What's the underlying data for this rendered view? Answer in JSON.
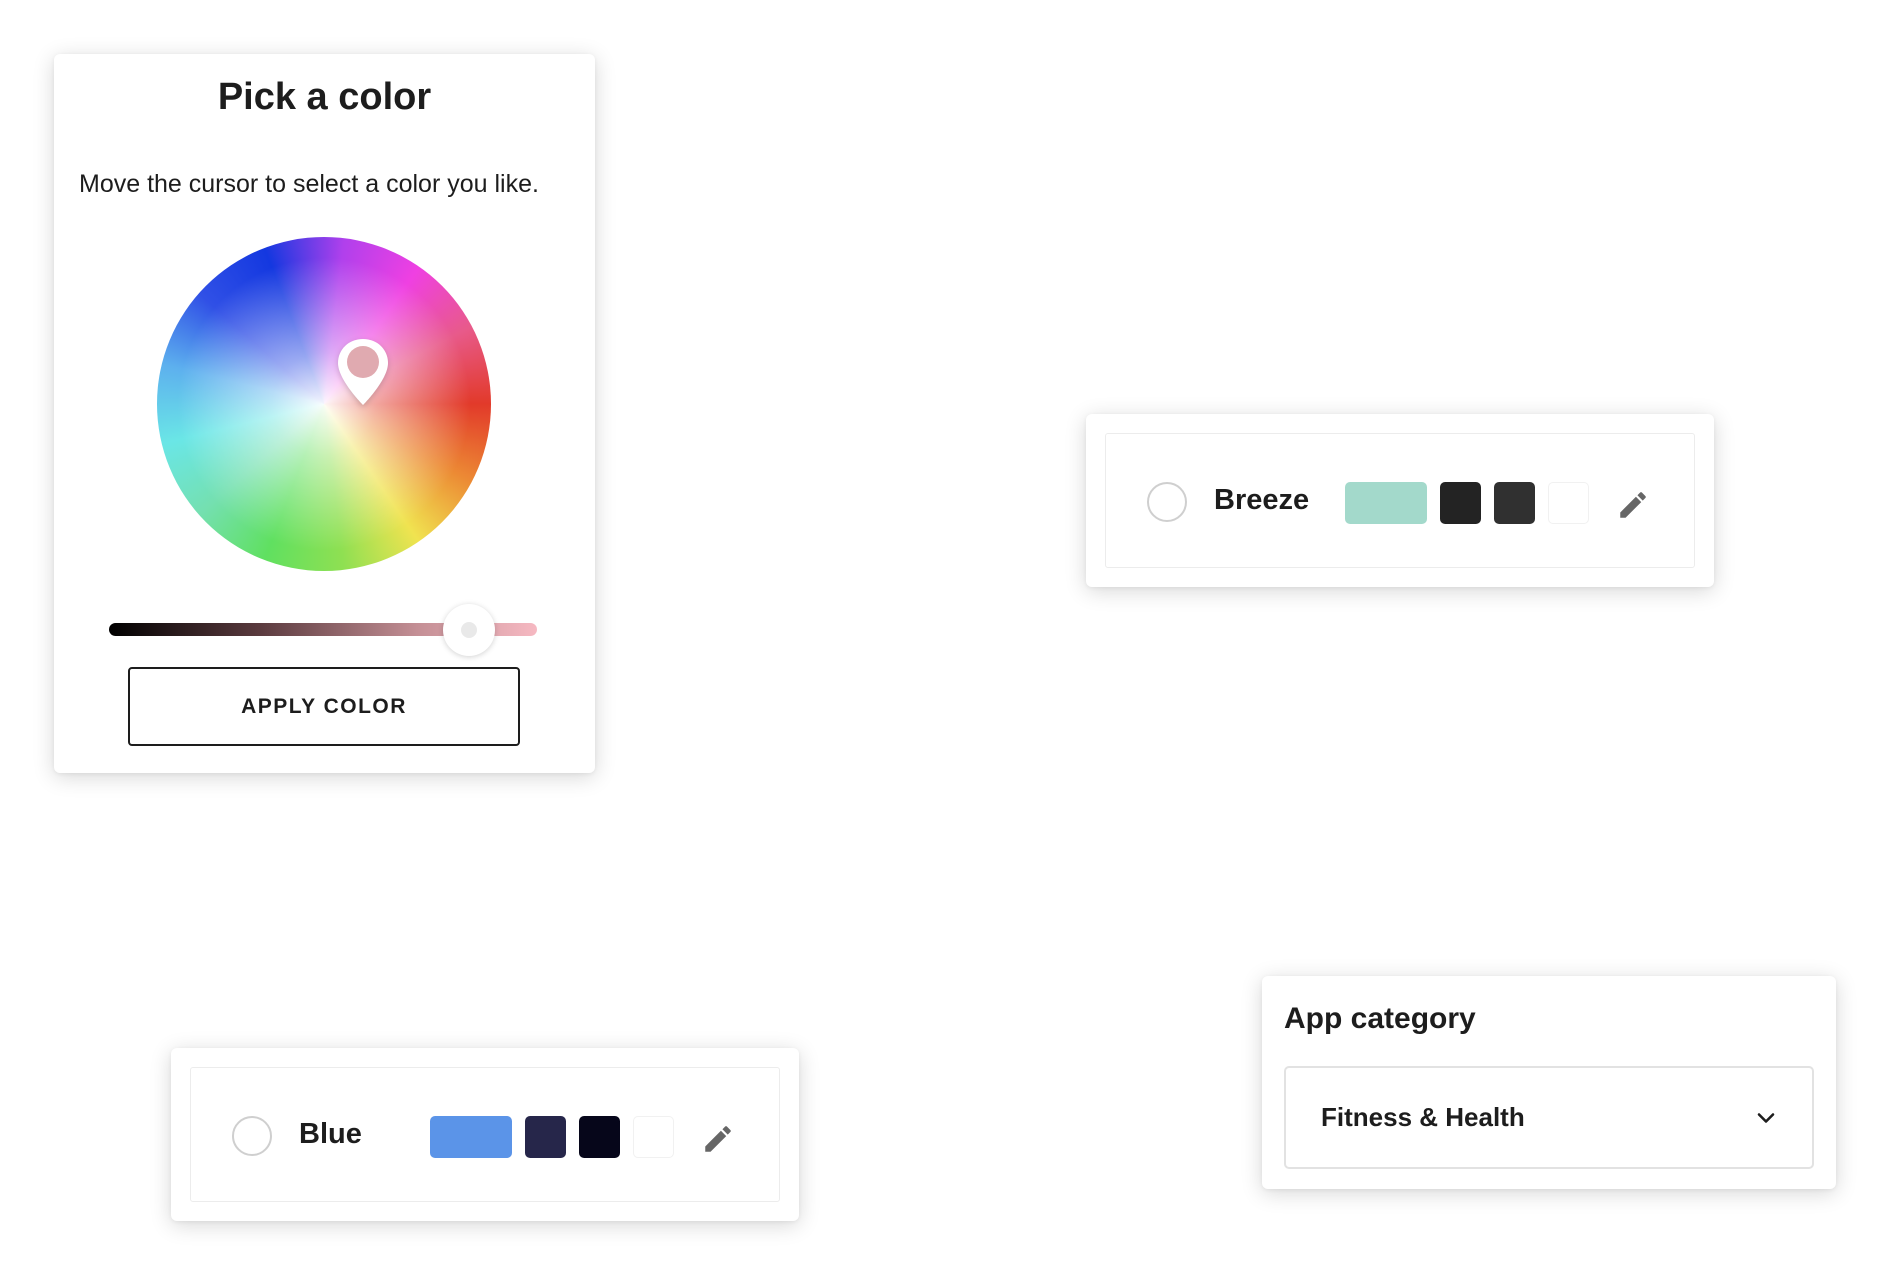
{
  "picker": {
    "title": "Pick a color",
    "description": "Move the cursor to select a color you like.",
    "selected_color": "#e0aab0",
    "brightness_percent": 84,
    "apply_label": "APPLY COLOR"
  },
  "palettes": [
    {
      "name": "Breeze",
      "selected": false,
      "swatches": [
        "#a3d9cb",
        "#232323",
        "#303030",
        "#ffffff"
      ],
      "edit_icon": "pencil-icon"
    },
    {
      "name": "Blue",
      "selected": false,
      "swatches": [
        "#5b94e8",
        "#26264a",
        "#06061a",
        "#ffffff"
      ],
      "edit_icon": "pencil-icon"
    }
  ],
  "category": {
    "label": "App category",
    "value": "Fitness & Health",
    "dropdown_icon": "chevron-down-icon"
  }
}
